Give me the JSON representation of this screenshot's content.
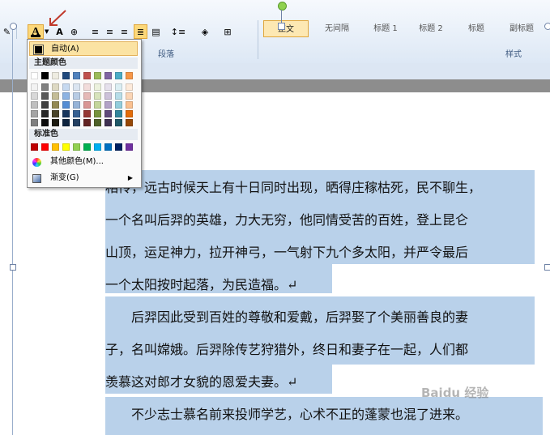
{
  "ribbon": {
    "paragraph_group_label": "段落",
    "styles_group_label": "样式",
    "style_gallery": [
      "正文",
      "无间隔",
      "标题 1",
      "标题 2",
      "标题",
      "副标题"
    ]
  },
  "color_menu": {
    "auto_label": "自动(A)",
    "theme_colors_label": "主题颜色",
    "standard_colors_label": "标准色",
    "more_colors_label": "其他颜色(M)...",
    "gradient_label": "渐变(G)",
    "theme_top_row": [
      "#ffffff",
      "#000000",
      "#eeece1",
      "#1f497d",
      "#4f81bd",
      "#c0504d",
      "#9bbb59",
      "#8064a2",
      "#4bacc6",
      "#f79646"
    ],
    "theme_shades": [
      [
        "#f2f2f2",
        "#7f7f7f",
        "#ddd9c3",
        "#c6d9f0",
        "#dbe5f1",
        "#f2dcdb",
        "#ebf1dd",
        "#e5e0ec",
        "#dbeef3",
        "#fdeada"
      ],
      [
        "#d8d8d8",
        "#595959",
        "#c4bd97",
        "#8db3e2",
        "#b8cce4",
        "#e5b9b7",
        "#d7e3bc",
        "#ccc1d9",
        "#b7dde8",
        "#fbd5b5"
      ],
      [
        "#bfbfbf",
        "#3f3f3f",
        "#938953",
        "#548dd4",
        "#95b3d7",
        "#d99694",
        "#c3d69b",
        "#b2a2c7",
        "#92cddc",
        "#fac08f"
      ],
      [
        "#a5a5a5",
        "#262626",
        "#494429",
        "#17365d",
        "#366092",
        "#953734",
        "#76923c",
        "#5f497a",
        "#31859b",
        "#e36c09"
      ],
      [
        "#7f7f7f",
        "#0c0c0c",
        "#1d1b10",
        "#0f243e",
        "#244061",
        "#632423",
        "#4f6128",
        "#3f3151",
        "#205867",
        "#974806"
      ]
    ],
    "standard_colors": [
      "#c00000",
      "#ff0000",
      "#ffc000",
      "#ffff00",
      "#92d050",
      "#00b050",
      "#00b0f0",
      "#0070c0",
      "#002060",
      "#7030a0"
    ],
    "auto_color": "#000000"
  },
  "document": {
    "lines": [
      "相传，远古时候天上有十日同时出现，晒得庄稼枯死，民不聊生，",
      "一个名叫后羿的英雄，力大无穷，他同情受苦的百姓，登上昆仑",
      "山顶，运足神力，拉开神弓，一气射下九个多太阳，并严令最后",
      "一个太阳按时起落，为民造福。↵",
      "　　后羿因此受到百姓的尊敬和爱戴，后羿娶了个美丽善良的妻",
      "子，名叫嫦娥。后羿除传艺狩猎外，终日和妻子在一起，人们都",
      "羡慕这对郎才女貌的恩爱夫妻。↵",
      "　　不少志士慕名前来投师学艺，心术不正的蓬蒙也混了进来。"
    ],
    "selection_color": "#b9d1ea"
  },
  "watermark": "Baidu 经验"
}
